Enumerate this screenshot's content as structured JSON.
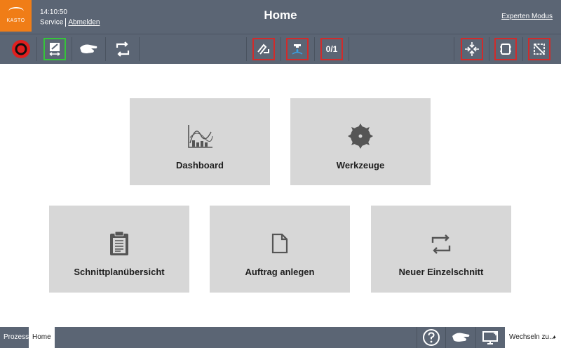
{
  "header": {
    "logo_text": "KASTO",
    "time": "14:10:50",
    "role": "Service",
    "logout_label": "Abmelden",
    "title": "Home",
    "expert_mode_label": "Experten Modus"
  },
  "toolbar": {
    "left_icons": [
      "stop-icon",
      "machine-transfer-icon",
      "hand-mode-icon",
      "cycle-icon"
    ],
    "middle_icons": [
      "saw-feed-icon",
      "coolant-icon",
      "counter-reset-icon"
    ],
    "right_icons": [
      "clamp-center-icon",
      "material-icon",
      "cut-corner-icon"
    ],
    "counter_text": "0/1"
  },
  "tiles": [
    {
      "label": "Dashboard",
      "icon": "dashboard-chart-icon"
    },
    {
      "label": "Werkzeuge",
      "icon": "saw-blade-icon"
    },
    {
      "label": "Schnittplanübersicht",
      "icon": "clipboard-icon"
    },
    {
      "label": "Auftrag anlegen",
      "icon": "document-icon"
    },
    {
      "label": "Neuer Einzelschnitt",
      "icon": "repeat-icon"
    }
  ],
  "footer": {
    "tabs": [
      "Prozess",
      "Home"
    ],
    "active_tab": "Home",
    "switch_label": "Wechseln zu..."
  },
  "colors": {
    "bar": "#5b6574",
    "accent_orange": "#f07d17",
    "alert_red": "#d12b2b",
    "active_green": "#35c43a",
    "tile": "#d7d7d7"
  }
}
